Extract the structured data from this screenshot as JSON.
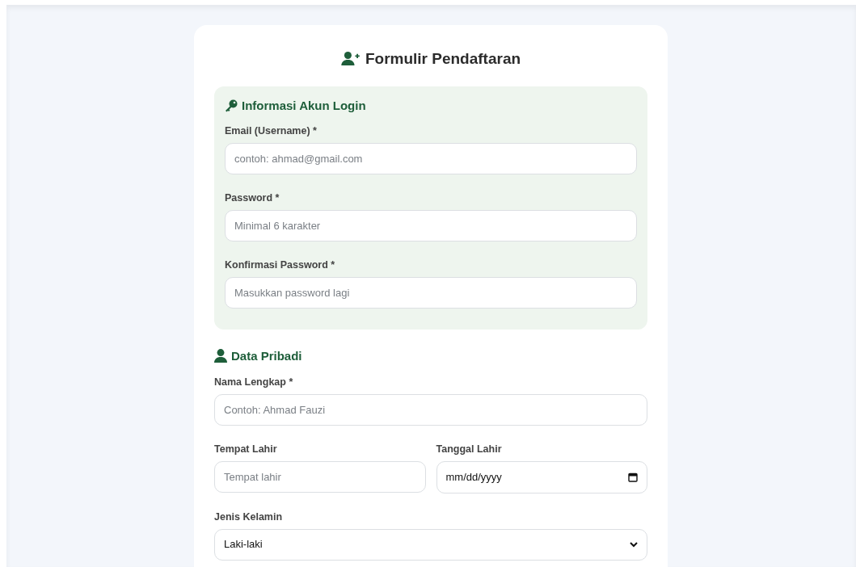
{
  "title": "Formulir Pendaftaran",
  "sections": [
    {
      "kind": "panel",
      "title": "Informasi Akun Login",
      "rows": [
        [
          {
            "kind": "text",
            "label": "Email (Username) *",
            "placeholder": "contoh: ahmad@gmail.com"
          }
        ],
        [
          {
            "kind": "text",
            "label": "Password *",
            "placeholder": "Minimal 6 karakter"
          }
        ],
        [
          {
            "kind": "text",
            "label": "Konfirmasi Password *",
            "placeholder": "Masukkan password lagi"
          }
        ]
      ]
    },
    {
      "kind": "plain",
      "title": "Data Pribadi",
      "rows": [
        [
          {
            "kind": "text",
            "label": "Nama Lengkap *",
            "placeholder": "Contoh: Ahmad Fauzi"
          }
        ],
        [
          {
            "kind": "text",
            "label": "Tempat Lahir",
            "placeholder": "Tempat lahir"
          },
          {
            "kind": "date",
            "label": "Tanggal Lahir",
            "value": "mm/dd/yyyy"
          }
        ],
        [
          {
            "kind": "select",
            "label": "Jenis Kelamin",
            "value": "Laki-laki"
          }
        ]
      ]
    }
  ]
}
